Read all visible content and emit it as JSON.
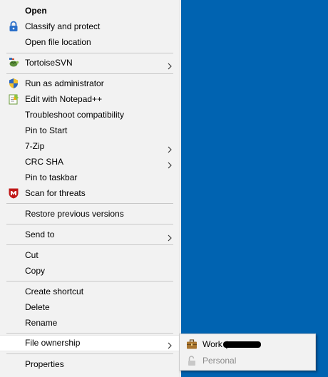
{
  "context_menu": {
    "items": [
      {
        "label": "Open",
        "bold": true
      },
      {
        "label": "Classify and protect",
        "icon": "lock-icon"
      },
      {
        "label": "Open file location"
      },
      {
        "label": "TortoiseSVN",
        "icon": "tortoise-icon",
        "submenu": true
      },
      {
        "label": "Run as administrator",
        "icon": "uac-shield-icon"
      },
      {
        "label": "Edit with Notepad++",
        "icon": "notepad-plus-plus-icon"
      },
      {
        "label": "Troubleshoot compatibility"
      },
      {
        "label": "Pin to Start"
      },
      {
        "label": "7-Zip",
        "submenu": true
      },
      {
        "label": "CRC SHA",
        "submenu": true
      },
      {
        "label": "Pin to taskbar"
      },
      {
        "label": "Scan for threats",
        "icon": "mcafee-shield-icon"
      },
      {
        "label": "Restore previous versions"
      },
      {
        "label": "Send to",
        "submenu": true
      },
      {
        "label": "Cut"
      },
      {
        "label": "Copy"
      },
      {
        "label": "Create shortcut"
      },
      {
        "label": "Delete"
      },
      {
        "label": "Rename"
      },
      {
        "label": "File ownership",
        "submenu": true,
        "highlighted": true
      },
      {
        "label": "Properties"
      }
    ]
  },
  "file_ownership_submenu": {
    "items": [
      {
        "label": "Work (",
        "icon": "briefcase-icon",
        "redacted_suffix": true
      },
      {
        "label": "Personal",
        "icon": "unlock-icon",
        "disabled": true
      }
    ]
  },
  "colors": {
    "desktop_background": "#0063b1",
    "menu_background": "#f2f2f2",
    "separator": "#c8c8c8"
  }
}
